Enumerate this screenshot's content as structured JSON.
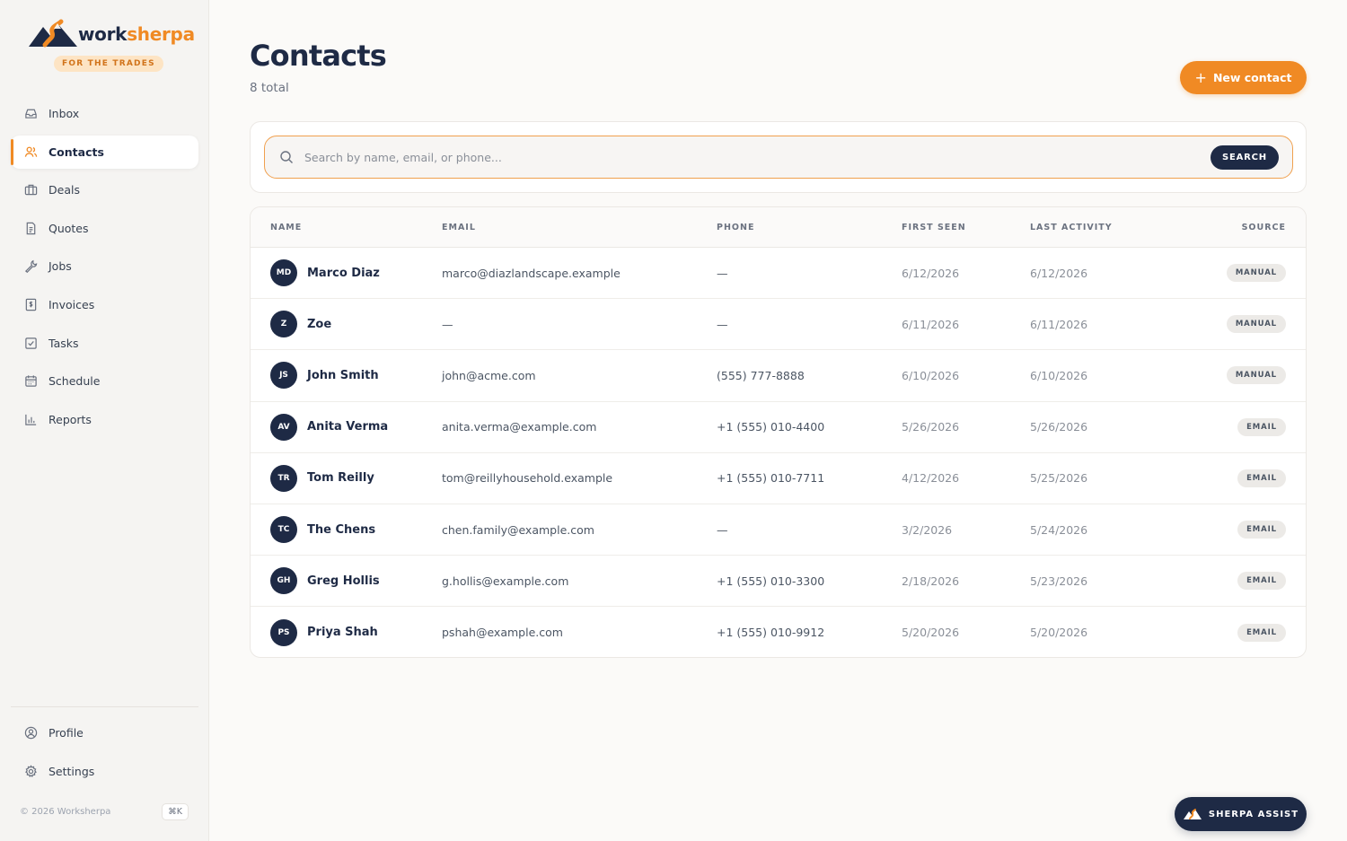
{
  "brand": {
    "name_part1": "work",
    "name_part2": "sherpa",
    "tagline": "FOR THE TRADES",
    "accent": "#f08a24",
    "navy": "#1e2a45"
  },
  "nav": {
    "items": [
      {
        "label": "Inbox",
        "icon": "inbox-icon",
        "active": false
      },
      {
        "label": "Contacts",
        "icon": "users-icon",
        "active": true
      },
      {
        "label": "Deals",
        "icon": "briefcase-icon",
        "active": false
      },
      {
        "label": "Quotes",
        "icon": "document-icon",
        "active": false
      },
      {
        "label": "Jobs",
        "icon": "wrench-icon",
        "active": false
      },
      {
        "label": "Invoices",
        "icon": "invoice-icon",
        "active": false
      },
      {
        "label": "Tasks",
        "icon": "checkbox-icon",
        "active": false
      },
      {
        "label": "Schedule",
        "icon": "calendar-icon",
        "active": false
      },
      {
        "label": "Reports",
        "icon": "bar-chart-icon",
        "active": false
      }
    ],
    "bottom": [
      {
        "label": "Profile",
        "icon": "user-circle-icon"
      },
      {
        "label": "Settings",
        "icon": "gear-icon"
      }
    ],
    "copyright": "© 2026 Worksherpa",
    "shortcut": "⌘K"
  },
  "page": {
    "title": "Contacts",
    "subtitle": "8 total",
    "new_button": "New contact"
  },
  "search": {
    "placeholder": "Search by name, email, or phone...",
    "value": "",
    "button": "SEARCH"
  },
  "table": {
    "columns": [
      "NAME",
      "EMAIL",
      "PHONE",
      "FIRST SEEN",
      "LAST ACTIVITY",
      "SOURCE"
    ],
    "rows": [
      {
        "initials": "MD",
        "name": "Marco Diaz",
        "email": "marco@diazlandscape.example",
        "phone": "—",
        "first_seen": "6/12/2026",
        "last_activity": "6/12/2026",
        "source": "MANUAL"
      },
      {
        "initials": "Z",
        "name": "Zoe",
        "email": "—",
        "phone": "—",
        "first_seen": "6/11/2026",
        "last_activity": "6/11/2026",
        "source": "MANUAL"
      },
      {
        "initials": "JS",
        "name": "John Smith",
        "email": "john@acme.com",
        "phone": "(555) 777-8888",
        "first_seen": "6/10/2026",
        "last_activity": "6/10/2026",
        "source": "MANUAL"
      },
      {
        "initials": "AV",
        "name": "Anita Verma",
        "email": "anita.verma@example.com",
        "phone": "+1 (555) 010-4400",
        "first_seen": "5/26/2026",
        "last_activity": "5/26/2026",
        "source": "EMAIL"
      },
      {
        "initials": "TR",
        "name": "Tom Reilly",
        "email": "tom@reillyhousehold.example",
        "phone": "+1 (555) 010-7711",
        "first_seen": "4/12/2026",
        "last_activity": "5/25/2026",
        "source": "EMAIL"
      },
      {
        "initials": "TC",
        "name": "The Chens",
        "email": "chen.family@example.com",
        "phone": "—",
        "first_seen": "3/2/2026",
        "last_activity": "5/24/2026",
        "source": "EMAIL"
      },
      {
        "initials": "GH",
        "name": "Greg Hollis",
        "email": "g.hollis@example.com",
        "phone": "+1 (555) 010-3300",
        "first_seen": "2/18/2026",
        "last_activity": "5/23/2026",
        "source": "EMAIL"
      },
      {
        "initials": "PS",
        "name": "Priya Shah",
        "email": "pshah@example.com",
        "phone": "+1 (555) 010-9912",
        "first_seen": "5/20/2026",
        "last_activity": "5/20/2026",
        "source": "EMAIL"
      }
    ]
  },
  "assist": {
    "label": "SHERPA ASSIST",
    "icon": "mountain-icon"
  }
}
